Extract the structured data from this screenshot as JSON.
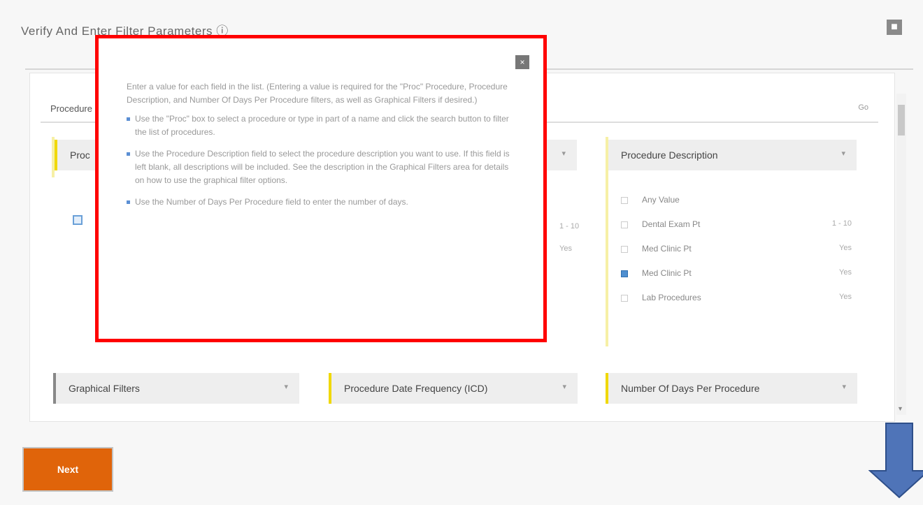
{
  "dialog": {
    "title": "Verify And Enter Filter Parameters ⓘ",
    "close_icon": "close-icon"
  },
  "search": {
    "label": "Procedure",
    "button": "Go"
  },
  "cards": [
    {
      "label": "Proc",
      "accent": "#f0d800"
    },
    {
      "label": "Procedure Description",
      "accent": "#f0d800"
    },
    {
      "label": "Graphical Filters",
      "accent": "#888888"
    },
    {
      "label": "Procedure Date Frequency (ICD)",
      "accent": "#f0d800"
    },
    {
      "label": "Number Of Days Per Procedure",
      "accent": "#f0d800"
    }
  ],
  "description_list": [
    {
      "name": "Any Value",
      "count": "",
      "checked": false
    },
    {
      "name": "Dental Exam Pt",
      "count": "1 - 10",
      "checked": false
    },
    {
      "name": "Med Clinic Pt",
      "count": "Yes",
      "checked": false
    },
    {
      "name": "Med Clinic Pt",
      "count": "Yes",
      "checked": true
    },
    {
      "name": "Lab Procedures",
      "count": "Yes",
      "checked": false
    }
  ],
  "middle_snippets": [
    "1 - 10",
    "Yes"
  ],
  "popup": {
    "intro": "Enter a value for each field in the list. (Entering a value is required for the \"Proc\" Procedure, Procedure Description, and Number Of Days Per Procedure filters, as well as Graphical Filters if desired.)",
    "bullets": [
      "Use the \"Proc\" box to select a procedure or type in part of a name and click the search button to filter the list of procedures.",
      "Use the Procedure Description field to select the procedure description you want to use. If this field is left blank, all descriptions will be included. See the description in the Graphical Filters area for details on how to use the graphical filter options.",
      "Use the Number of Days Per Procedure field to enter the number of days."
    ],
    "close_label": "×"
  },
  "footer": {
    "next_button": "Next"
  },
  "colors": {
    "highlight_border": "#ff0000",
    "next_button": "#e0640a",
    "arrow": "#4f74b8"
  }
}
